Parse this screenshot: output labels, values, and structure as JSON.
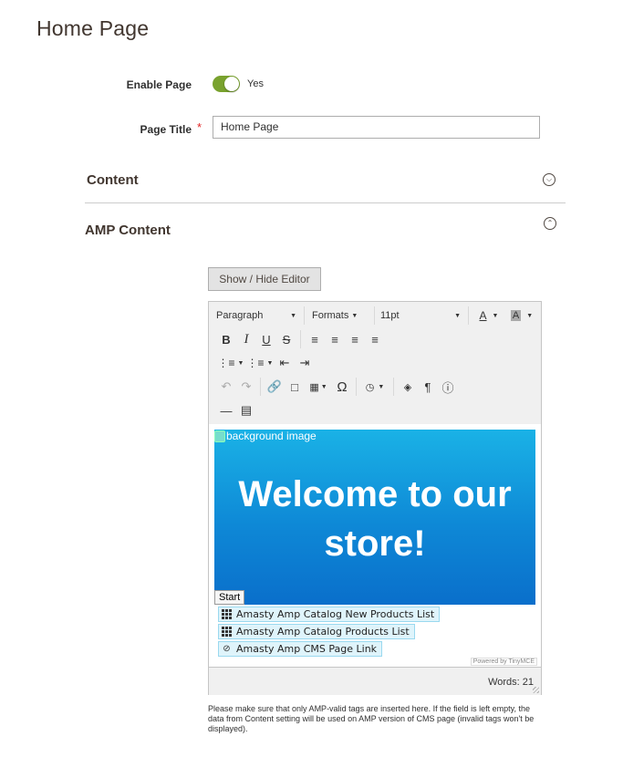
{
  "page": {
    "title": "Home Page"
  },
  "form": {
    "enable_page": {
      "label": "Enable Page",
      "value": "Yes"
    },
    "page_title": {
      "label": "Page Title",
      "required_mark": "*",
      "value": "Home Page"
    }
  },
  "sections": {
    "content": {
      "title": "Content",
      "state_icon": "chevron-down-circle-icon"
    },
    "amp_content": {
      "title": "AMP Content",
      "state_icon": "chevron-up-circle-icon"
    }
  },
  "editor": {
    "toggle_button": "Show / Hide Editor",
    "toolbar": {
      "block_format": "Paragraph",
      "formats": "Formats",
      "font_size": "11pt",
      "icons": [
        "text-color-icon",
        "background-color-icon",
        "bold-icon",
        "italic-icon",
        "underline-icon",
        "strikethrough-icon",
        "align-left-icon",
        "align-center-icon",
        "align-right-icon",
        "align-justify-icon",
        "bullet-list-icon",
        "numbered-list-icon",
        "outdent-icon",
        "indent-icon",
        "undo-icon",
        "redo-icon",
        "link-icon",
        "bookmark-icon",
        "table-icon",
        "special-character-icon",
        "insert-time-icon",
        "find-replace-icon",
        "show-blocks-icon",
        "help-icon",
        "horizontal-rule-icon",
        "page-break-icon"
      ]
    },
    "content": {
      "image_alt": "background image",
      "hero_text": "Welcome to our store!",
      "start_button": "Start",
      "widgets": [
        {
          "label": "Amasty Amp Catalog New Products List",
          "icon": "grid-icon"
        },
        {
          "label": "Amasty Amp Catalog Products List",
          "icon": "grid-icon"
        },
        {
          "label": "Amasty Amp CMS Page Link",
          "icon": "link-leaf-icon"
        }
      ],
      "powered_by": "Powered by TinyMCE"
    },
    "status": {
      "words": "Words: 21"
    }
  },
  "help_text": "Please make sure that only AMP-valid tags are inserted here. If the field is left empty, the data from Content setting will be used on AMP version of CMS page (invalid tags won't be displayed).",
  "colors": {
    "toggle_on": "#79a22e",
    "hero_top": "#1ab2e6",
    "hero_bottom": "#0a6fcb",
    "required": "#e22626"
  }
}
